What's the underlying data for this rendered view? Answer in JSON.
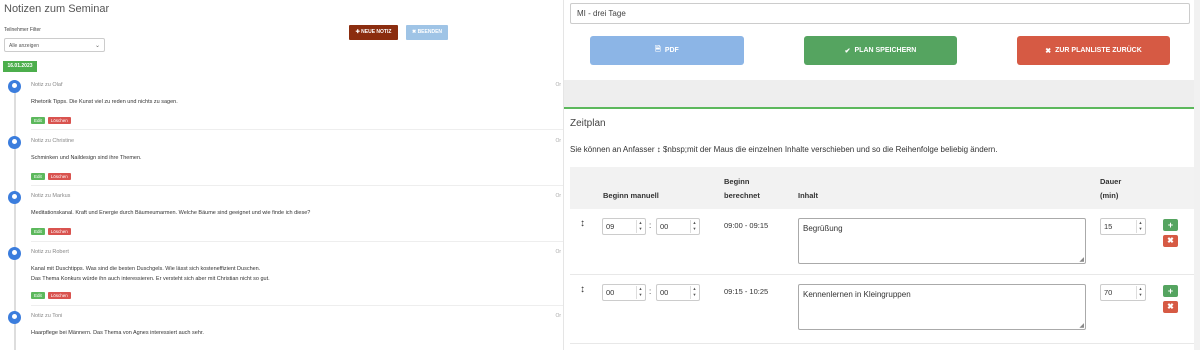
{
  "left": {
    "title": "Notizen zum Seminar",
    "filter_label": "Teilnehmer Filter",
    "filter_value": "Alle anzeigen",
    "new_note_label": "✚ NEUE NOTIZ",
    "end_label": "✖ BEENDEN",
    "date": "16.01.2023",
    "edit_label": "Edit",
    "delete_label": "Löschen",
    "notes": [
      {
        "head": "Notiz zu Olaf",
        "more": "Or",
        "text": "Rhetorik Tipps. Die Kunst viel zu reden und nichts zu sagen."
      },
      {
        "head": "Notiz zu Christine",
        "more": "Or",
        "text": "Schminken und Naildesign sind ihre Themen."
      },
      {
        "head": "Notiz zu Markus",
        "more": "Or",
        "text": "Meditationskanal. Kraft und Energie durch Bäumeumarmen. Welche Bäume sind geeignet und wie finde ich diese?"
      },
      {
        "head": "Notiz zu Robert",
        "more": "Or",
        "text": "Kanal mit Duschtipps. Was sind die besten Duschgels. Wie lässt sich kosteneffizient Duschen.",
        "text2": "Das Thema Konkurs würde ihn auch interessieren. Er versteht sich aber mit Christian nicht so gut."
      },
      {
        "head": "Notiz zu Toni",
        "more": "Or",
        "text": "Haarpflege bei Männern. Das Thema von Agnes interessiert auch sehr."
      }
    ]
  },
  "right": {
    "plan_name": "MI - drei Tage",
    "pdf_label": "PDF",
    "save_label": "PLAN SPEICHERN",
    "back_label": "ZUR PLANLISTE ZURÜCK",
    "section_title": "Zeitplan",
    "hint_before": "Sie können an Anfasser",
    "hint_arrow": "↕",
    "hint_after": "$nbsp;mit der Maus die einzelnen Inhalte verschieben und so die Reihenfolge beliebig ändern.",
    "columns": {
      "begin_manual": "Beginn manuell",
      "begin_calc_1": "Beginn",
      "begin_calc_2": "berechnet",
      "content": "Inhalt",
      "duration_1": "Dauer",
      "duration_2": "(min)"
    },
    "rows": [
      {
        "hh": "09",
        "mm": "00",
        "calc": "09:00 - 09:15",
        "content": "Begrüßung",
        "duration": "15"
      },
      {
        "hh": "00",
        "mm": "00",
        "calc": "09:15 - 10:25",
        "content": "Kennenlernen in Kleingruppen",
        "duration": "70"
      }
    ]
  },
  "colors": {
    "new_note": "#8b2d0f",
    "end": "#9fc4e6",
    "date_badge": "#4cae4c",
    "pdf": "#8cb5e6",
    "save": "#55a460",
    "back": "#d65a44",
    "timeline_dot": "#3b7ddd"
  }
}
